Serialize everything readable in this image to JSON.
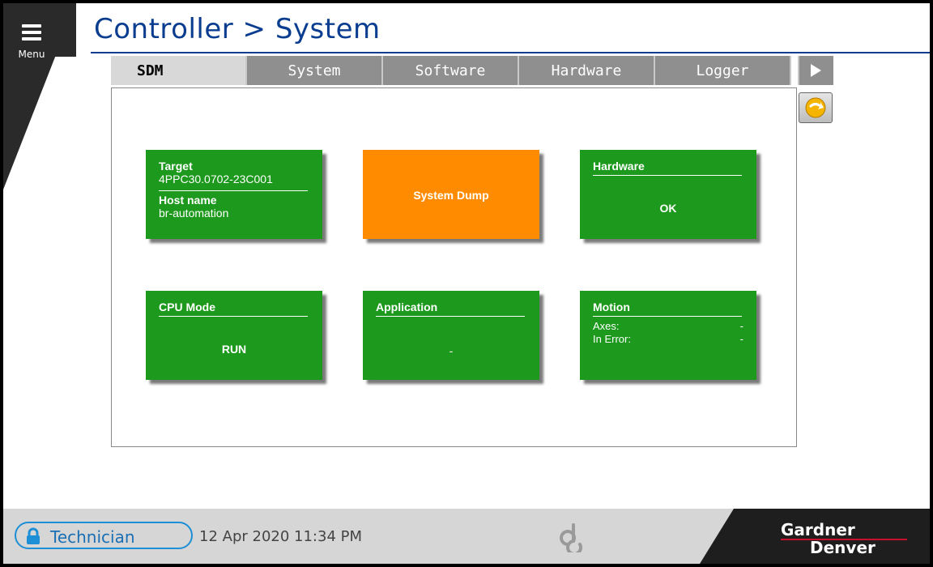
{
  "menu": {
    "label": "Menu"
  },
  "header": {
    "title": "Controller > System"
  },
  "tabs": [
    {
      "label": "SDM",
      "active": true
    },
    {
      "label": "System",
      "active": false
    },
    {
      "label": "Software",
      "active": false
    },
    {
      "label": "Hardware",
      "active": false
    },
    {
      "label": "Logger",
      "active": false
    }
  ],
  "tiles": {
    "target": {
      "header": "Target",
      "value": "4PPC30.0702-23C001",
      "host_label": "Host name",
      "host_value": "br-automation",
      "color": "#1d9a1d"
    },
    "system_dump": {
      "label": "System Dump",
      "color": "#ff8c00"
    },
    "hardware": {
      "header": "Hardware",
      "status": "OK",
      "color": "#1d9a1d"
    },
    "cpu_mode": {
      "header": "CPU Mode",
      "status": "RUN",
      "color": "#1d9a1d"
    },
    "application": {
      "header": "Application",
      "status": "-",
      "color": "#1d9a1d"
    },
    "motion": {
      "header": "Motion",
      "axes_label": "Axes:",
      "axes_value": "-",
      "error_label": "In Error:",
      "error_value": "-",
      "color": "#1d9a1d"
    }
  },
  "status_bar": {
    "user": "Technician",
    "datetime": "12 Apr 2020  11:34 PM",
    "brand_line1": "Gardner",
    "brand_line2": "Denver",
    "accent": "#1d8fd6"
  },
  "icons": {
    "menu": "hamburger-icon",
    "next": "play-arrow-icon",
    "refresh": "return-arrow-icon",
    "lock": "lock-icon",
    "logo": "fan-logo-icon"
  }
}
